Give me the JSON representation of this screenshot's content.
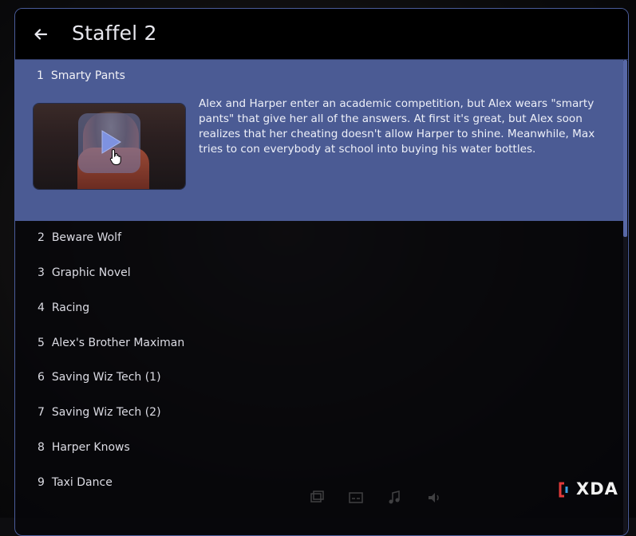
{
  "header": {
    "title": "Staffel 2",
    "back_icon": "arrow-left-icon"
  },
  "active_episode": {
    "number": "1",
    "title": "Smarty Pants",
    "description": "Alex and Harper enter an academic competition, but Alex wears \"smarty pants\" that give her all of the answers. At first it's great, but Alex soon realizes that her cheating doesn't allow Harper to shine. Meanwhile, Max tries to con everybody at school into buying his water bottles.",
    "thumbnail_icon": "play-icon"
  },
  "episodes": [
    {
      "number": "2",
      "title": "Beware Wolf"
    },
    {
      "number": "3",
      "title": "Graphic Novel"
    },
    {
      "number": "4",
      "title": "Racing"
    },
    {
      "number": "5",
      "title": "Alex's Brother Maximan"
    },
    {
      "number": "6",
      "title": "Saving Wiz Tech (1)"
    },
    {
      "number": "7",
      "title": "Saving Wiz Tech (2)"
    },
    {
      "number": "8",
      "title": "Harper Knows"
    },
    {
      "number": "9",
      "title": "Taxi Dance"
    }
  ],
  "watermark": {
    "text": "XDA"
  },
  "colors": {
    "accent": "#4b5b94",
    "panel_border": "#4a5c9a",
    "scroll_thumb": "#5868a6",
    "text": "#dcdce4"
  }
}
